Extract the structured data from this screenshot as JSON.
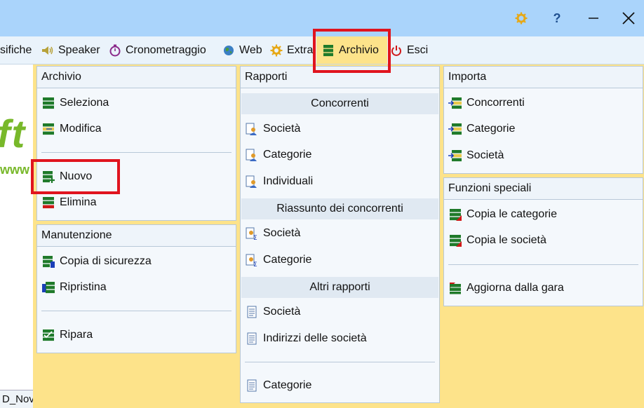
{
  "menubar": {
    "items": [
      {
        "id": "classifiche",
        "label": "sifiche"
      },
      {
        "id": "speaker",
        "label": "Speaker",
        "icon": "speaker-icon"
      },
      {
        "id": "cronometraggio",
        "label": "Cronometraggio",
        "icon": "stopwatch-icon"
      },
      {
        "id": "web",
        "label": "Web",
        "icon": "globe-icon"
      },
      {
        "id": "extra",
        "label": "Extra",
        "icon": "gear-icon"
      },
      {
        "id": "archivio",
        "label": "Archivio",
        "icon": "database-icon",
        "active": true
      },
      {
        "id": "esci",
        "label": "Esci",
        "icon": "power-icon"
      }
    ]
  },
  "titlebar": {
    "help_label": "?"
  },
  "left_strip": {
    "big_text": "ft",
    "small_text": "www",
    "tab_text": "D_Nov"
  },
  "panels": {
    "archivio": {
      "title": "Archivio",
      "items": [
        {
          "label": "Seleziona",
          "icon": "database-select-icon"
        },
        {
          "label": "Modifica",
          "icon": "database-edit-icon"
        },
        {
          "label": "Nuovo",
          "icon": "database-add-icon"
        },
        {
          "label": "Elimina",
          "icon": "database-delete-icon"
        }
      ]
    },
    "manutenzione": {
      "title": "Manutenzione",
      "items": [
        {
          "label": "Copia di sicurezza",
          "icon": "backup-icon"
        },
        {
          "label": "Ripristina",
          "icon": "restore-icon"
        },
        {
          "label": "Ripara",
          "icon": "repair-icon"
        }
      ]
    },
    "rapporti": {
      "title": "Rapporti",
      "sections": [
        {
          "title": "Concorrenti",
          "items": [
            {
              "label": "Società",
              "icon": "report-people-icon"
            },
            {
              "label": "Categorie",
              "icon": "report-people-icon"
            },
            {
              "label": "Individuali",
              "icon": "report-people-icon"
            }
          ]
        },
        {
          "title": "Riassunto dei concorrenti",
          "items": [
            {
              "label": "Società",
              "icon": "report-summary-icon"
            },
            {
              "label": "Categorie",
              "icon": "report-summary-icon"
            }
          ]
        },
        {
          "title": "Altri rapporti",
          "items": [
            {
              "label": "Società",
              "icon": "document-icon"
            },
            {
              "label": "Indirizzi delle società",
              "icon": "document-icon"
            },
            {
              "label": "Categorie",
              "icon": "document-icon"
            }
          ]
        }
      ]
    },
    "importa": {
      "title": "Importa",
      "items": [
        {
          "label": "Concorrenti",
          "icon": "import-icon"
        },
        {
          "label": "Categorie",
          "icon": "import-icon"
        },
        {
          "label": "Società",
          "icon": "import-icon"
        }
      ]
    },
    "funzioni_speciali": {
      "title": "Funzioni speciali",
      "items": [
        {
          "label": "Copia le categorie",
          "icon": "copy-database-icon"
        },
        {
          "label": "Copia le società",
          "icon": "copy-database-icon"
        },
        {
          "label": "Aggiorna dalla gara",
          "icon": "update-database-icon"
        }
      ]
    }
  },
  "colors": {
    "accent": "#fde38a",
    "titlebar": "#aad4fb",
    "highlight": "#e0141e",
    "brand_green": "#78b82a"
  }
}
